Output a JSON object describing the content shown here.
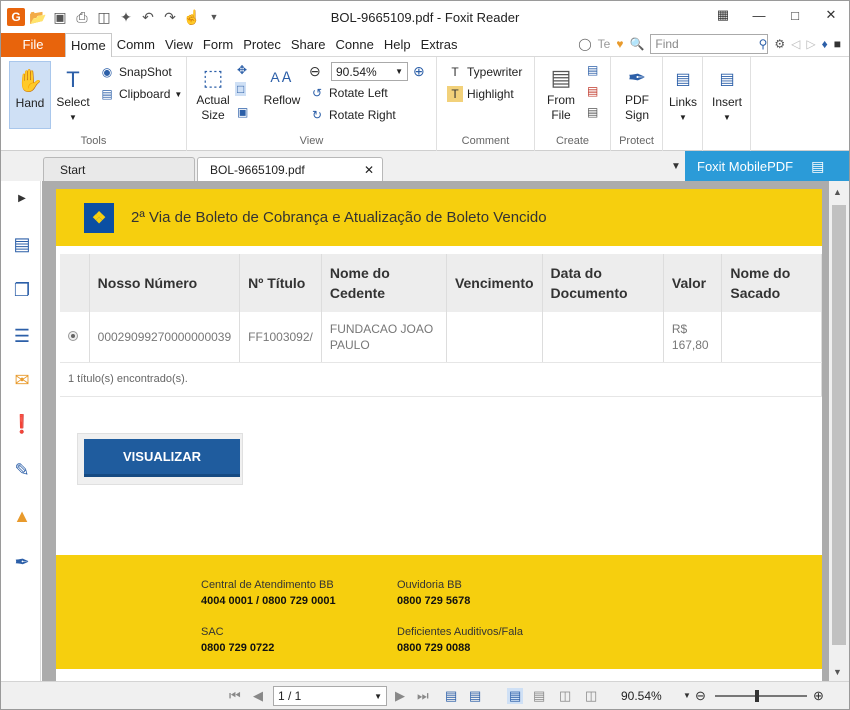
{
  "app": {
    "title": "BOL-9665109.pdf - Foxit Reader",
    "win_controls": [
      "restore-icon",
      "minimize-icon",
      "maximize-icon",
      "close-icon"
    ]
  },
  "menu": {
    "file": "File",
    "tabs": [
      "Home",
      "Comm",
      "View",
      "Form",
      "Protec",
      "Share",
      "Conne",
      "Help",
      "Extras"
    ],
    "tell_me": "Te",
    "find_placeholder": "Find"
  },
  "ribbon": {
    "tools": {
      "hand": "Hand",
      "select": "Select",
      "snapshot": "SnapShot",
      "clipboard": "Clipboard",
      "label": "Tools"
    },
    "view": {
      "actual_size_1": "Actual",
      "actual_size_2": "Size",
      "reflow": "Reflow",
      "zoom_value": "90.54%",
      "rotate_left": "Rotate Left",
      "rotate_right": "Rotate Right",
      "label": "View"
    },
    "comment": {
      "typewriter": "Typewriter",
      "highlight": "Highlight",
      "label": "Comment"
    },
    "create": {
      "from_file_1": "From",
      "from_file_2": "File",
      "label": "Create"
    },
    "protect": {
      "pdf_sign_1": "PDF",
      "pdf_sign_2": "Sign",
      "label": "Protect"
    },
    "links": "Links",
    "insert": "Insert"
  },
  "tabs": {
    "start": "Start",
    "doc": "BOL-9665109.pdf",
    "mobile": "Foxit MobilePDF"
  },
  "doc": {
    "header_title": "2ª Via de Boleto de Cobrança e Atualização de Boleto Vencido",
    "columns": [
      "",
      "Nosso Número",
      "Nº Título",
      "Nome do Cedente",
      "Vencimento",
      "Data do Documento",
      "Valor",
      "Nome do Sacado"
    ],
    "row": {
      "nosso_numero": "00029099270000000039",
      "titulo": "FF1003092/",
      "cedente": "FUNDACAO JOAO PAULO",
      "vencimento": "",
      "data_documento": "",
      "valor": "R$ 167,80",
      "sacado": ""
    },
    "footer_count": "1 título(s) encontrado(s).",
    "button": "VISUALIZAR",
    "footer": {
      "central_label": "Central de Atendimento BB",
      "central_value": "4004 0001 / 0800 729 0001",
      "ouvidoria_label": "Ouvidoria BB",
      "ouvidoria_value": "0800 729 5678",
      "sac_label": "SAC",
      "sac_value": "0800 729 0722",
      "deficientes_label": "Deficientes Auditivos/Fala",
      "deficientes_value": "0800 729 0088"
    },
    "colors": {
      "bb_yellow": "#f6cf0e",
      "bb_blue": "#1f5c9e",
      "foxit_orange": "#e8640c"
    }
  },
  "status": {
    "page": "1 / 1",
    "zoom": "90.54%"
  }
}
